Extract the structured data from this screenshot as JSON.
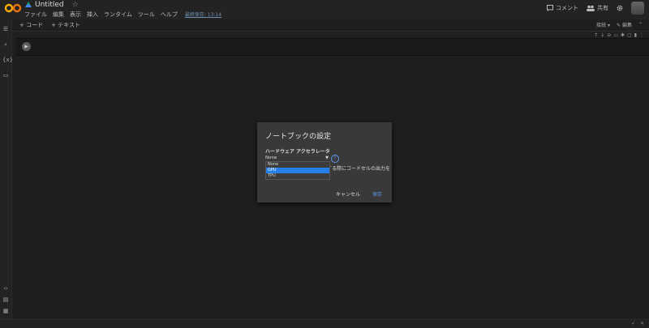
{
  "header": {
    "title": "Untitled",
    "star": "☆",
    "menu": [
      "ファイル",
      "編集",
      "表示",
      "挿入",
      "ランタイム",
      "ツール",
      "ヘルプ"
    ],
    "last_saved": "最終保存: 13:14",
    "comment_label": "コメント",
    "share_label": "共有"
  },
  "toolbar": {
    "add_code": "+ コード",
    "add_text": "+ テキスト",
    "connect": "接続",
    "edit": "編集"
  },
  "dialog": {
    "title": "ノートブックの設定",
    "label": "ハードウェア アクセラレータ",
    "selected": "None",
    "options": [
      "None",
      "GPU",
      "TPU"
    ],
    "highlighted": "GPU",
    "help": "?",
    "background_text": "する際にコードセルの出力を",
    "cancel": "キャンセル",
    "save": "保存"
  },
  "colors": {
    "accent": "#2680eb",
    "link": "#5b9be6",
    "logo": "#f9ab00"
  }
}
